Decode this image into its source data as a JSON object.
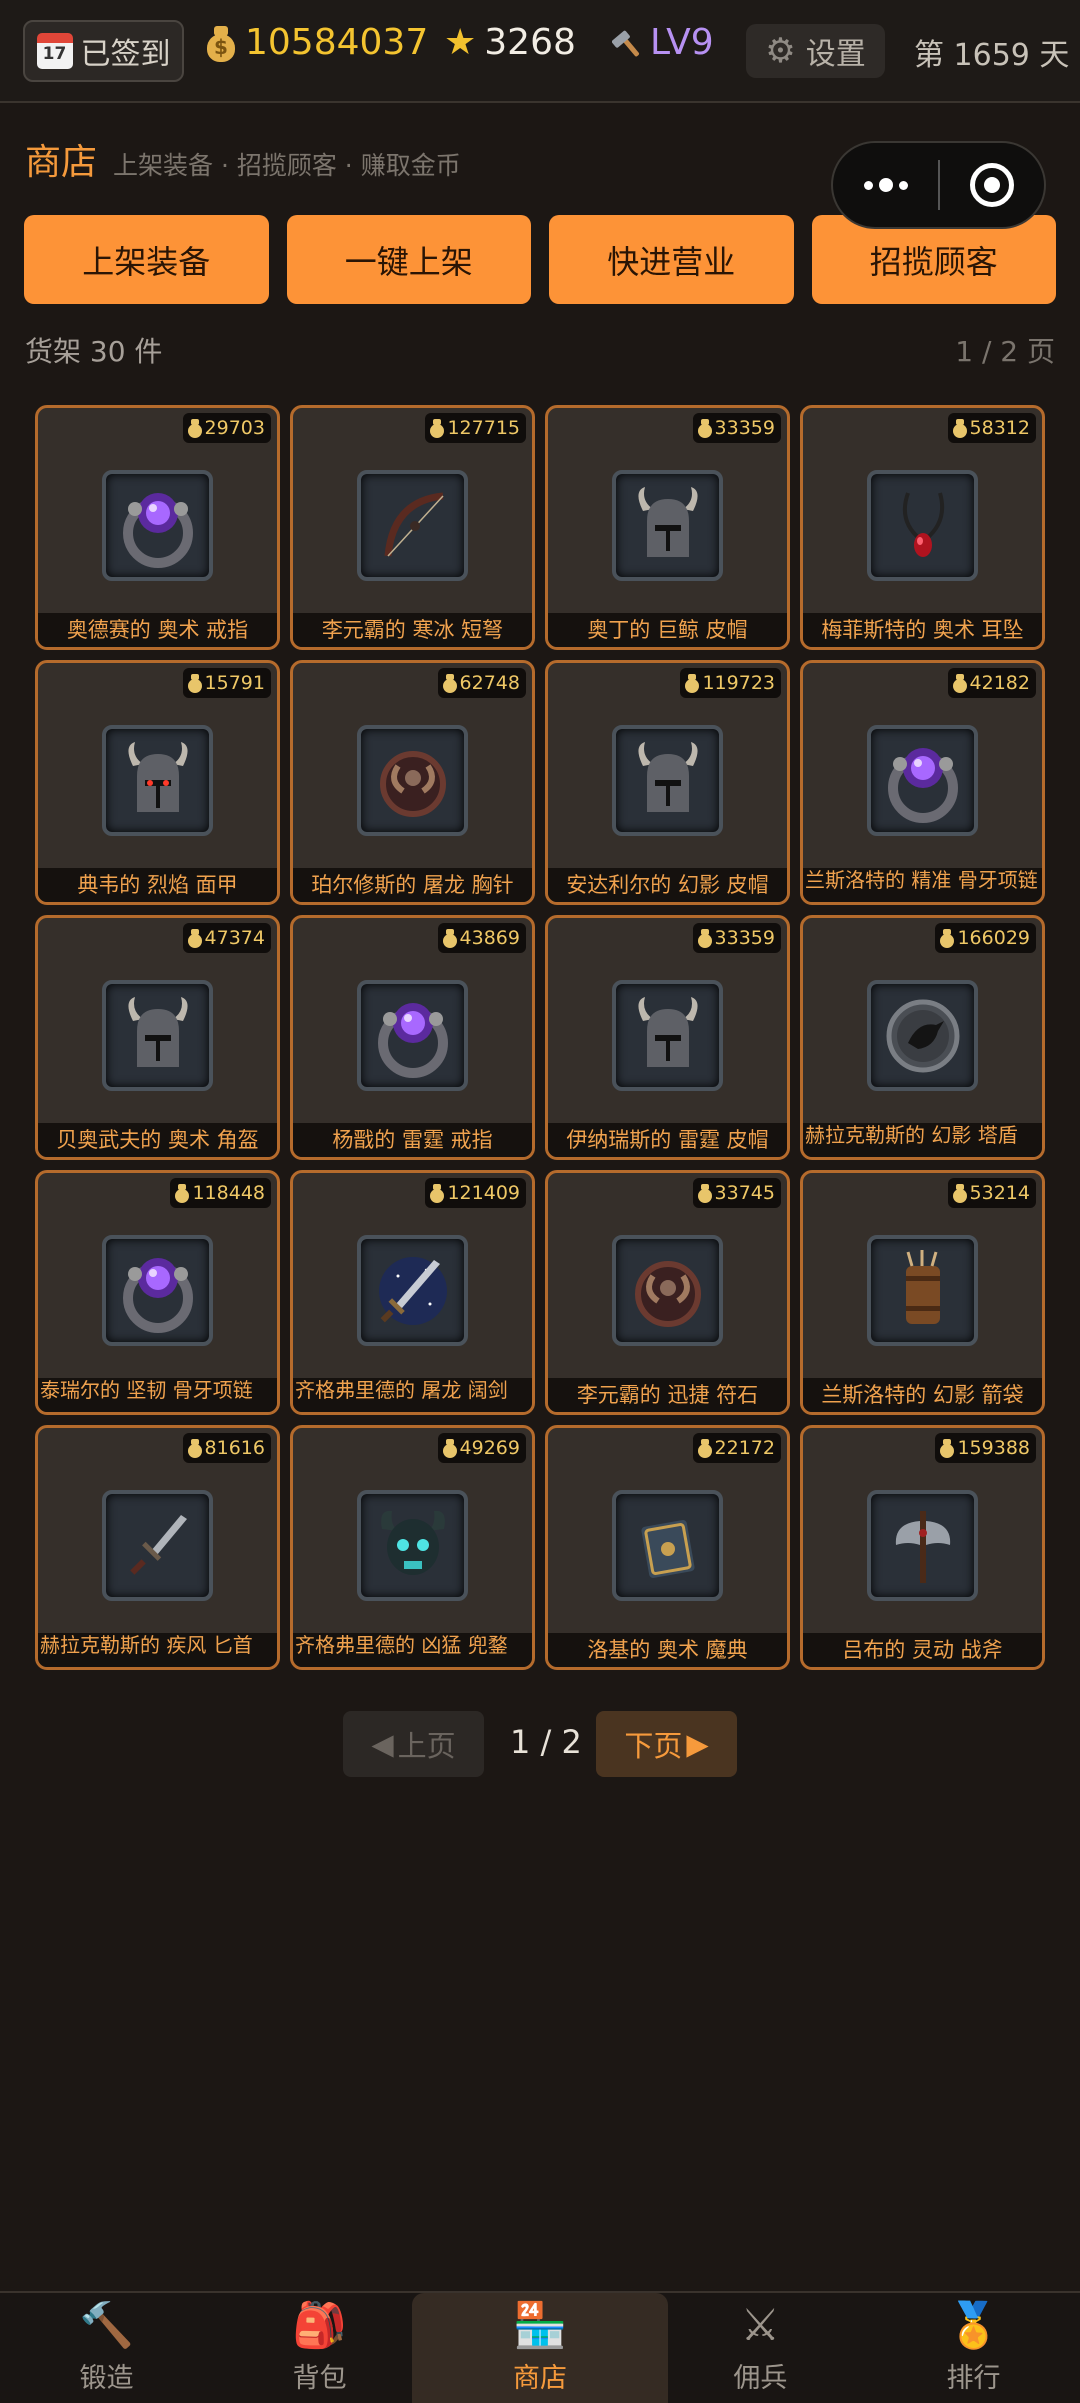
{
  "topbar": {
    "checkin_label": "已签到",
    "calendar_day": "17",
    "gold": "10584037",
    "stars": "3268",
    "level": "LV9",
    "settings_label": "设置",
    "day_counter": "第 1659 天"
  },
  "header": {
    "title": "商店",
    "subtitle": "上架装备 · 招揽顾客 · 赚取金币"
  },
  "actions": [
    "上架装备",
    "一键上架",
    "快进营业",
    "招揽顾客"
  ],
  "shelf": {
    "count_label": "货架 30 件",
    "page_label": "1 / 2 页"
  },
  "items": [
    {
      "price": "29703",
      "name": "奥德赛的 奥术 戒指",
      "icon": "purple-ring"
    },
    {
      "price": "127715",
      "name": "李元霸的 寒冰 短弩",
      "icon": "bow"
    },
    {
      "price": "33359",
      "name": "奥丁的 巨鲸 皮帽",
      "icon": "horned-helmet"
    },
    {
      "price": "58312",
      "name": "梅菲斯特的 奥术 耳坠",
      "icon": "ruby-amulet"
    },
    {
      "price": "15791",
      "name": "典韦的 烈焰 面甲",
      "icon": "horned-helmet-red"
    },
    {
      "price": "62748",
      "name": "珀尔修斯的 屠龙 胸针",
      "icon": "ram-ring"
    },
    {
      "price": "119723",
      "name": "安达利尔的 幻影 皮帽",
      "icon": "horned-helmet"
    },
    {
      "price": "42182",
      "name": "兰斯洛特的 精准 骨牙项链",
      "icon": "purple-ring"
    },
    {
      "price": "47374",
      "name": "贝奥武夫的 奥术 角盔",
      "icon": "horned-helmet"
    },
    {
      "price": "43869",
      "name": "杨戬的 雷霆 戒指",
      "icon": "purple-ring"
    },
    {
      "price": "33359",
      "name": "伊纳瑞斯的 雷霆 皮帽",
      "icon": "horned-helmet"
    },
    {
      "price": "166029",
      "name": "赫拉克勒斯的 幻影 塔盾",
      "icon": "raven-shield"
    },
    {
      "price": "118448",
      "name": "泰瑞尔的 坚韧 骨牙项链",
      "icon": "purple-ring"
    },
    {
      "price": "121409",
      "name": "齐格弗里德的 屠龙 阔剑",
      "icon": "starry-sword"
    },
    {
      "price": "33745",
      "name": "李元霸的 迅捷 符石",
      "icon": "ram-ring"
    },
    {
      "price": "53214",
      "name": "兰斯洛特的 幻影 箭袋",
      "icon": "quiver"
    },
    {
      "price": "81616",
      "name": "赫拉克勒斯的 疾风 匕首",
      "icon": "dagger"
    },
    {
      "price": "49269",
      "name": "齐格弗里德的 凶猛 兜鍪",
      "icon": "skull-helm"
    },
    {
      "price": "22172",
      "name": "洛基的 奥术 魔典",
      "icon": "tome"
    },
    {
      "price": "159388",
      "name": "吕布的 灵动 战斧",
      "icon": "battle-axe"
    }
  ],
  "pager": {
    "prev_label": "上页",
    "current": "1 / 2",
    "next_label": "下页"
  },
  "tabs": [
    {
      "label": "锻造",
      "icon": "hammer-icon",
      "glyph": "🔨"
    },
    {
      "label": "背包",
      "icon": "backpack-icon",
      "glyph": "🎒"
    },
    {
      "label": "商店",
      "icon": "store-icon",
      "glyph": "🏪"
    },
    {
      "label": "佣兵",
      "icon": "crossed-swords-icon",
      "glyph": "⚔"
    },
    {
      "label": "排行",
      "icon": "medal-icon",
      "glyph": "🏅"
    }
  ],
  "colors": {
    "accent": "#fd9337",
    "gold": "#f4c430",
    "level": "#b791f2",
    "card_border": "#b56b2c",
    "background": "#1c1714"
  }
}
